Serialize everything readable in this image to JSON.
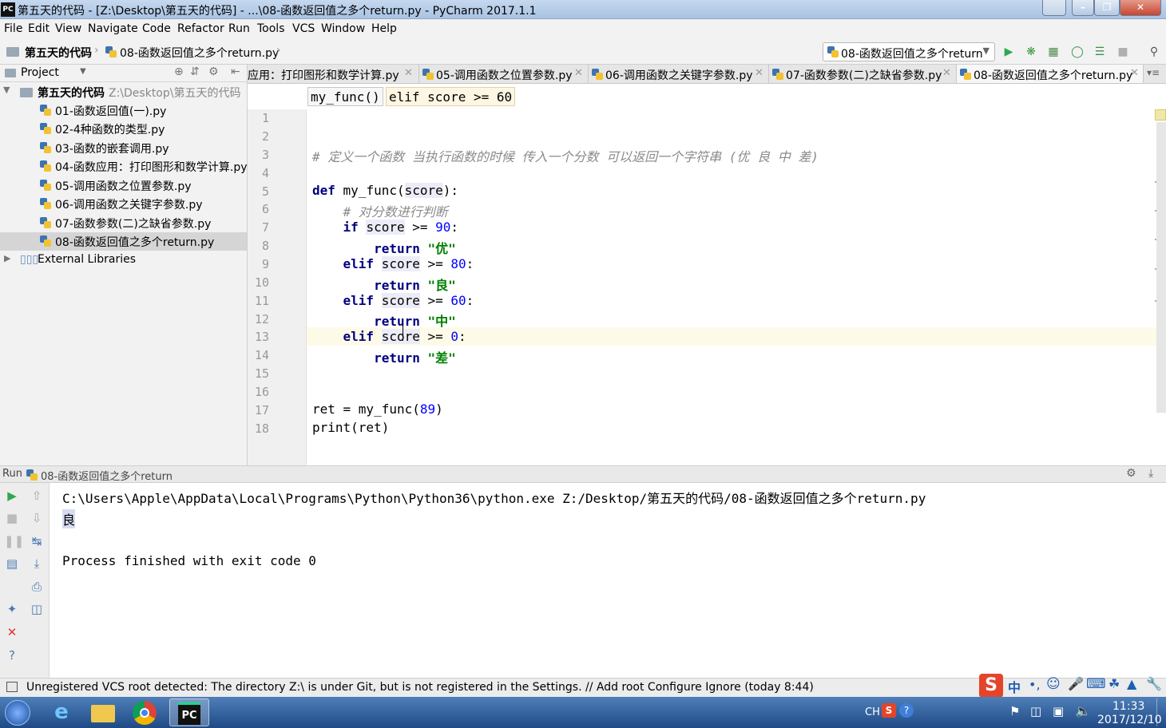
{
  "window": {
    "app_icon": "PC",
    "title": "第五天的代码 - [Z:\\Desktop\\第五天的代码] - ...\\08-函数返回值之多个return.py - PyCharm 2017.1.1"
  },
  "menu": [
    "File",
    "Edit",
    "View",
    "Navigate",
    "Code",
    "Refactor",
    "Run",
    "Tools",
    "VCS",
    "Window",
    "Help"
  ],
  "navbar": {
    "project": "第五天的代码",
    "file": "08-函数返回值之多个return.py",
    "run_config": "08-函数返回值之多个return"
  },
  "project_panel": {
    "header": "Project",
    "root_name": "第五天的代码",
    "root_path": "Z:\\Desktop\\第五天的代码",
    "files": [
      "01-函数返回值(一).py",
      "02-4种函数的类型.py",
      "03-函数的嵌套调用.py",
      "04-函数应用：打印图形和数学计算.py",
      "05-调用函数之位置参数.py",
      "06-调用函数之关键字参数.py",
      "07-函数参数(二)之缺省参数.py",
      "08-函数返回值之多个return.py"
    ],
    "selected_index": 7,
    "external": "External Libraries"
  },
  "tabs": [
    {
      "label": "应用：打印图形和数学计算.py"
    },
    {
      "label": "05-调用函数之位置参数.py"
    },
    {
      "label": "06-调用函数之关键字参数.py"
    },
    {
      "label": "07-函数参数(二)之缺省参数.py"
    },
    {
      "label": "08-函数返回值之多个return.py",
      "active": true
    }
  ],
  "breadcrumb": [
    "my_func()",
    "elif score >= 60"
  ],
  "line_numbers": [
    "1",
    "2",
    "3",
    "4",
    "5",
    "6",
    "7",
    "8",
    "9",
    "10",
    "11",
    "12",
    "13",
    "14",
    "15",
    "16",
    "17",
    "18"
  ],
  "code": {
    "l3": "# 定义一个函数 当执行函数的时候 传入一个分数 可以返回一个字符串 (优 良 中 差)",
    "l6": "    # 对分数进行判断",
    "def_kw": "def",
    "fn_name": "my_func",
    "param": "score",
    "if_kw": "if",
    "elif_kw": "elif",
    "return_kw": "return",
    "ge": " >= ",
    "colon": ":",
    "n90": "90",
    "n80": "80",
    "n60": "60",
    "n0": "0",
    "s_you": "\"优\"",
    "s_liang": "\"良\"",
    "s_zhong": "\"中\"",
    "s_cha": "\"差\"",
    "l17_a": "ret = my_func(",
    "l17_n": "89",
    "l17_b": ")",
    "l18": "print(ret)"
  },
  "run": {
    "header_label": "Run",
    "config": "08-函数返回值之多个return",
    "cmd": "C:\\Users\\Apple\\AppData\\Local\\Programs\\Python\\Python36\\python.exe Z:/Desktop/第五天的代码/08-函数返回值之多个return.py",
    "output": "良",
    "exit": "Process finished with exit code 0"
  },
  "status": {
    "message": "Unregistered VCS root detected: The directory Z:\\ is under Git, but is not registered in the Settings. // Add root  Configure  Ignore (today 8:44)"
  },
  "taskbar": {
    "lang": "CH",
    "time": "11:33",
    "date": "2017/12/10",
    "ime_label": "中"
  },
  "colors": {
    "run_green": "#2fa84f",
    "keyword": "#000080",
    "string": "#008000",
    "number": "#0000ff",
    "comment": "#8a8a8a"
  }
}
